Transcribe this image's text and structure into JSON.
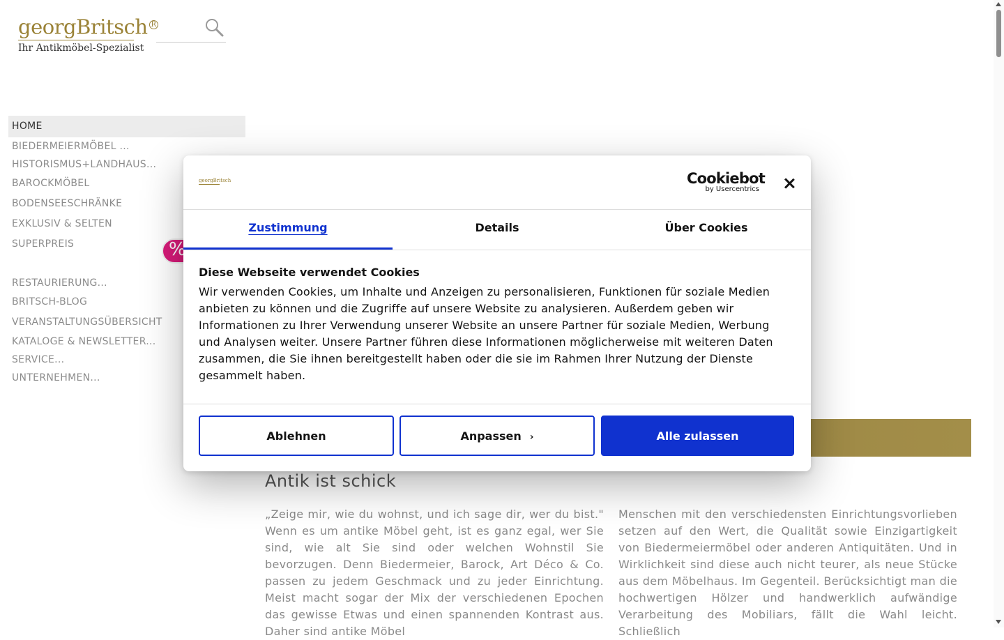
{
  "header": {
    "logo_main": "georgBritsch",
    "logo_mark": "R",
    "logo_tagline": "Ihr Antikmöbel-Spezialist",
    "search_icon": "search-icon"
  },
  "nav": {
    "items": [
      {
        "label": "HOME"
      },
      {
        "label": "BIEDERMEIERMÖBEL ..."
      },
      {
        "label": "HISTORISMUS+LANDHAUS..."
      },
      {
        "label": "BAROCKMÖBEL"
      },
      {
        "label": "BODENSEESCHRÄNKE"
      },
      {
        "label": "EXKLUSIV & SELTEN"
      },
      {
        "label": "SUPERPREIS"
      },
      {
        "label": "RESTAURIERUNG..."
      },
      {
        "label": "BRITSCH-BLOG"
      },
      {
        "label": "VERANSTALTUNGSÜBERSICHT"
      },
      {
        "label": "KATALOGE & NEWSLETTER..."
      },
      {
        "label": "SERVICE..."
      },
      {
        "label": "UNTERNEHMEN..."
      }
    ],
    "badge": "%"
  },
  "main": {
    "headline": "Antik ist schick",
    "col_left": "„Zeige mir, wie du wohnst, und ich sage dir, wer du bist.\" Wenn es um antike Möbel geht, ist es ganz egal, wer Sie sind, wie alt Sie sind oder welchen Wohnstil Sie bevorzugen. Denn Biedermeier, Barock, Art Déco & Co. passen zu jedem Geschmack und zu jeder Einrichtung. Meist macht sogar der Mix der verschiedenen Epochen das gewisse Etwas und einen spannenden Kontrast aus. Daher sind antike Möbel",
    "col_right": "Menschen mit den verschiedensten Einrichtungsvorlieben setzen auf den Wert, die Qualität sowie Einzigartigkeit von Biedermeiermöbel oder anderen Antiquitäten. Und in Wirklichkeit sind diese auch nicht teurer, als neue Stücke aus dem Möbelhaus. Im Gegenteil. Berücksichtigt man die hochwertigen Hölzer und handwerklich aufwändige Verarbeitung des Mobiliars, fällt die Wahl leicht. Schließlich"
  },
  "cookie_dialog": {
    "brand": "Cookiebot",
    "brand_sub": "by Usercentrics",
    "mini_logo": "georgBritsch",
    "tabs": [
      {
        "label": "Zustimmung"
      },
      {
        "label": "Details"
      },
      {
        "label": "Über Cookies"
      }
    ],
    "title": "Diese Webseite verwendet Cookies",
    "text": "Wir verwenden Cookies, um Inhalte und Anzeigen zu personalisieren, Funktionen für soziale Medien anbieten zu können und die Zugriffe auf unsere Website zu analysieren. Außerdem geben wir Informationen zu Ihrer Verwendung unserer Website an unsere Partner für soziale Medien, Werbung und Analysen weiter. Unsere Partner führen diese Informationen möglicherweise mit weiteren Daten zusammen, die Sie ihnen bereitgestellt haben oder die sie im Rahmen Ihrer Nutzung der Dienste gesammelt haben.",
    "buttons": {
      "decline": "Ablehnen",
      "customize": "Anpassen",
      "customize_chevron": "›",
      "allow_all": "Alle zulassen"
    },
    "accent_color": "#1032cf"
  },
  "colors": {
    "brand_gold": "#9a8236",
    "badge_pink": "#d81b7a"
  }
}
